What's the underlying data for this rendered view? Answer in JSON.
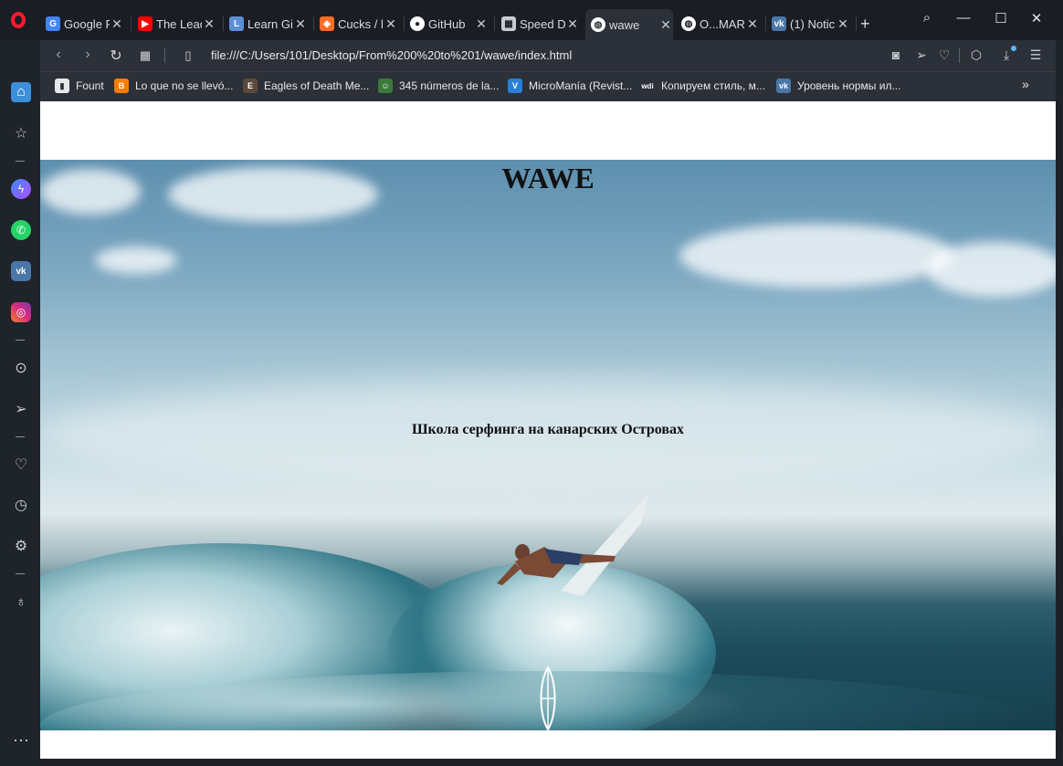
{
  "browser": {
    "tabs": [
      {
        "title": "Google F",
        "icon": "google-translate-icon",
        "color": "#4285f4"
      },
      {
        "title": "The Lead",
        "icon": "youtube-icon",
        "color": "#ff0000"
      },
      {
        "title": "Learn Gi",
        "icon": "learn-git-icon",
        "color": "#5b8fd6"
      },
      {
        "title": "Cucks / l",
        "icon": "gitlab-icon",
        "color": "#fc6d26"
      },
      {
        "title": "GitHub",
        "icon": "github-icon",
        "color": "#ffffff"
      },
      {
        "title": "Speed D",
        "icon": "speed-dial-icon",
        "color": "#c7ccd4"
      },
      {
        "title": "wawe",
        "icon": "globe-icon",
        "color": "#ffffff",
        "active": true
      },
      {
        "title": "O...MARI",
        "icon": "globe-icon",
        "color": "#ffffff"
      },
      {
        "title": "(1) Notic",
        "icon": "vk-icon",
        "color": "#4a76a8"
      }
    ],
    "new_tab": "+",
    "url": "file:///C:/Users/101/Desktop/From%200%20to%201/wawe/index.html",
    "bookmarks": [
      {
        "label": "Fount",
        "icon": "page-icon",
        "color": "#e6e8eb"
      },
      {
        "label": "Lo que no se llevó...",
        "icon": "blogger-icon",
        "color": "#f57d00"
      },
      {
        "label": "Eagles of Death Me...",
        "icon": "band-icon",
        "color": "#5a4a3a"
      },
      {
        "label": "345 números de la...",
        "icon": "face-icon",
        "color": "#3a7a3a"
      },
      {
        "label": "MicroManía (Revist...",
        "icon": "micromania-icon",
        "color": "#2a7fd4"
      },
      {
        "label": "Копируем стиль, м...",
        "icon": "wdi-icon",
        "color": "#2c3038"
      },
      {
        "label": "Уровень нормы ил...",
        "icon": "vk-icon",
        "color": "#4a76a8"
      }
    ],
    "more_bookmarks": "»"
  },
  "page": {
    "title": "WAWE",
    "subtitle": "Школа серфинга на канарских Островах"
  }
}
